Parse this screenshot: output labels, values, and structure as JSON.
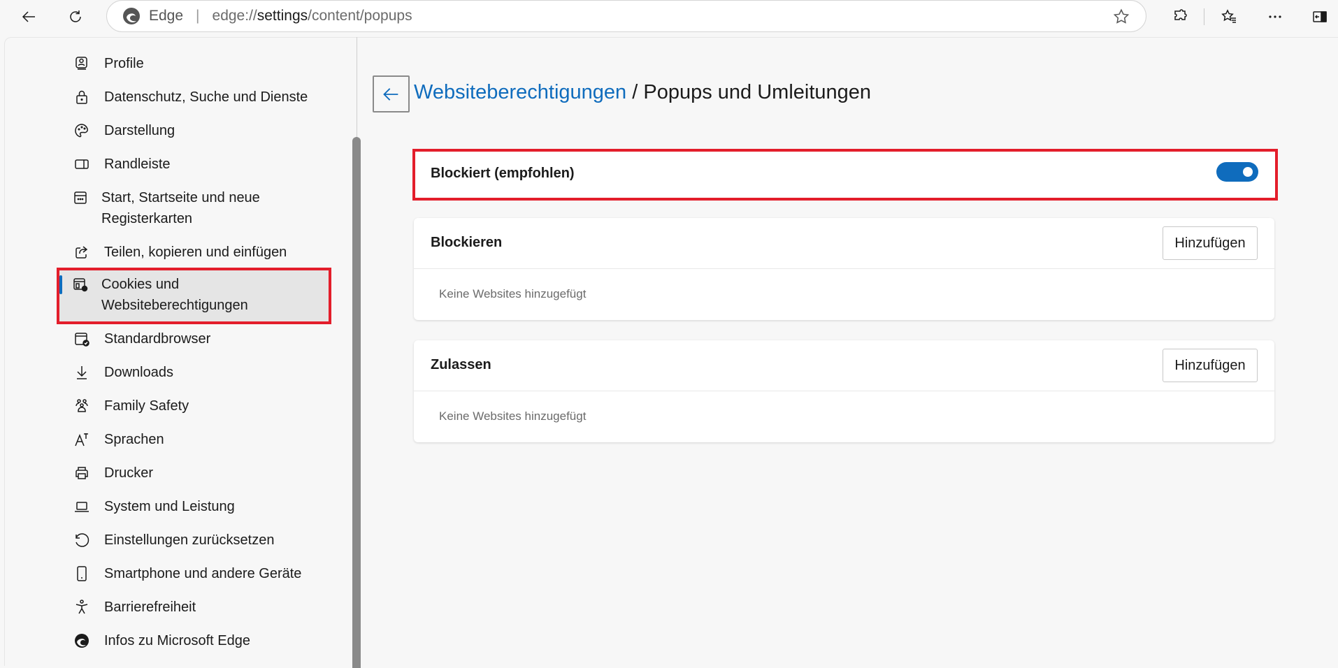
{
  "toolbar": {
    "back_icon": "arrow-left-icon",
    "refresh_icon": "refresh-icon",
    "address": {
      "site_label": "Edge",
      "url_prefix": "edge://",
      "url_host": "settings",
      "url_path": "/content/popups"
    },
    "favorite_icon": "star-outline-icon",
    "extensions_icon": "puzzle-icon",
    "favorites_icon": "star-list-icon",
    "menu_icon": "more-dots-icon",
    "sidebar_icon": "sidebar-toggle-icon"
  },
  "sidebar": {
    "items": [
      {
        "label": "Profile",
        "icon": "profile-icon"
      },
      {
        "label": "Datenschutz, Suche und Dienste",
        "icon": "lock-icon"
      },
      {
        "label": "Darstellung",
        "icon": "palette-icon"
      },
      {
        "label": "Randleiste",
        "icon": "sidebar-panel-icon"
      },
      {
        "label": "Start, Startseite und neue Registerkarten",
        "icon": "start-page-icon"
      },
      {
        "label": "Teilen, kopieren und einfügen",
        "icon": "share-icon"
      },
      {
        "label": "Cookies und Websiteberechtigungen",
        "icon": "cookies-settings-icon",
        "active": true
      },
      {
        "label": "Standardbrowser",
        "icon": "default-browser-icon"
      },
      {
        "label": "Downloads",
        "icon": "download-icon"
      },
      {
        "label": "Family Safety",
        "icon": "family-icon"
      },
      {
        "label": "Sprachen",
        "icon": "languages-icon"
      },
      {
        "label": "Drucker",
        "icon": "printer-icon"
      },
      {
        "label": "System und Leistung",
        "icon": "laptop-icon"
      },
      {
        "label": "Einstellungen zurücksetzen",
        "icon": "reset-icon"
      },
      {
        "label": "Smartphone und andere Geräte",
        "icon": "phone-icon"
      },
      {
        "label": "Barrierefreiheit",
        "icon": "accessibility-icon"
      },
      {
        "label": "Infos zu Microsoft Edge",
        "icon": "edge-logo-icon"
      }
    ]
  },
  "main": {
    "breadcrumb_link": "Websiteberechtigungen",
    "breadcrumb_rest": " / Popups und Umleitungen",
    "blocked_toggle": {
      "label": "Blockiert (empfohlen)",
      "on": true
    },
    "sections": [
      {
        "title": "Blockieren",
        "button": "Hinzufügen",
        "empty_text": "Keine Websites hinzugefügt"
      },
      {
        "title": "Zulassen",
        "button": "Hinzufügen",
        "empty_text": "Keine Websites hinzugefügt"
      }
    ]
  },
  "colors": {
    "accent": "#0f6cbd",
    "highlight_outline": "#e31e2b",
    "background": "#f7f7f7"
  }
}
